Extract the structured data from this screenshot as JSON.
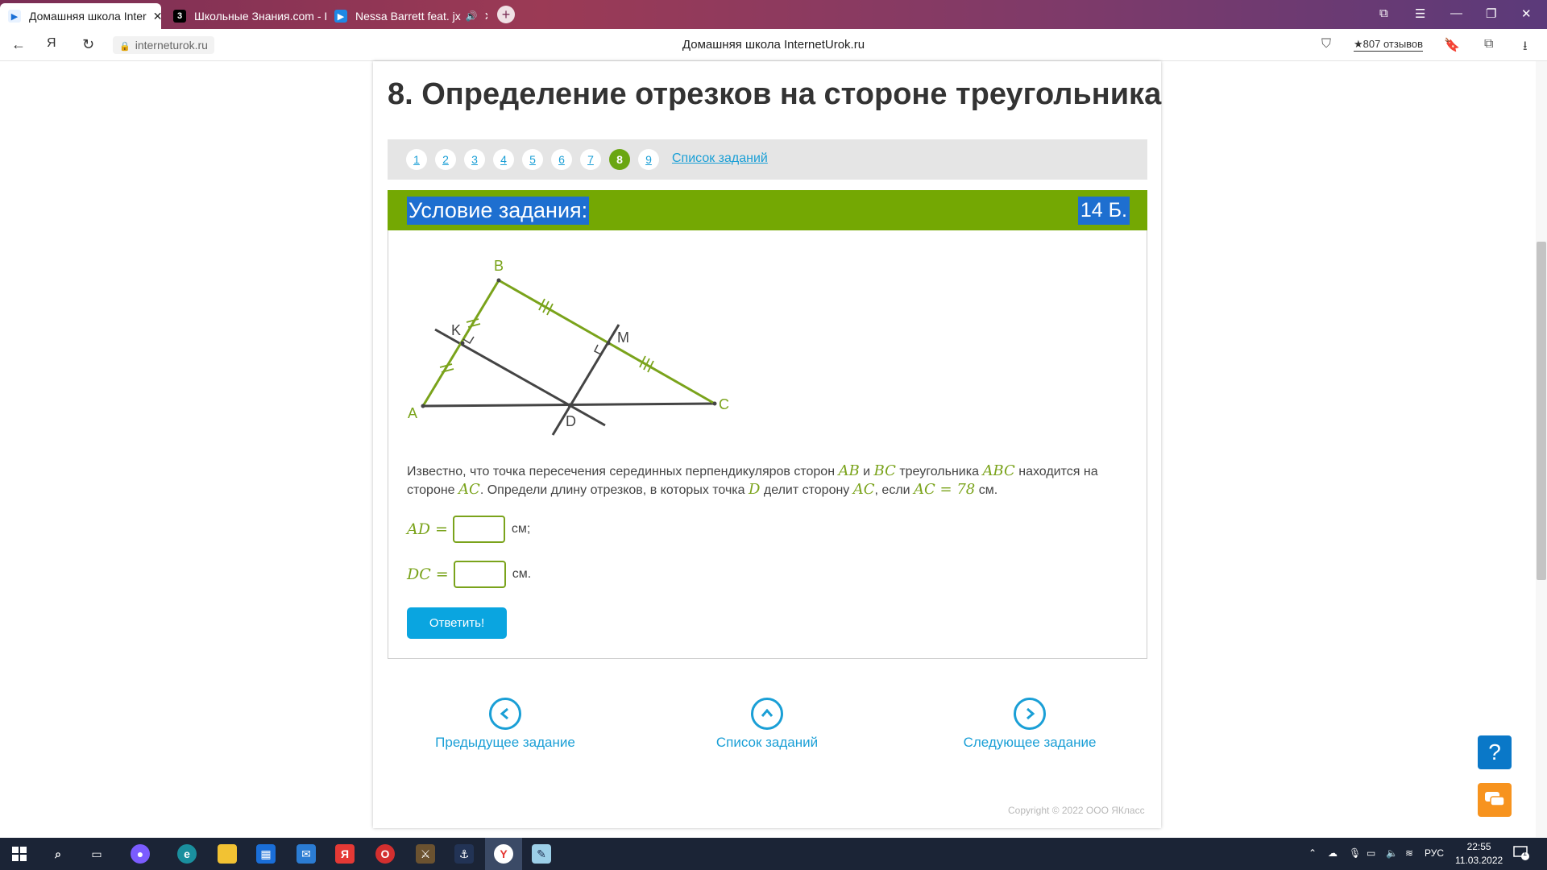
{
  "browser": {
    "tabs": [
      {
        "label": "Домашняя школа Inter",
        "active": true
      },
      {
        "label": "Школьные Знания.com - I",
        "active": false
      },
      {
        "label": "Nessa Barrett feat. jx",
        "active": false
      }
    ],
    "new_tab": "+",
    "url": "interneturok.ru",
    "page_title": "Домашняя школа InternetUrok.ru",
    "reviews": "★807 отзывов"
  },
  "page": {
    "title": "8. Определение отрезков на стороне треугольника",
    "task_numbers": [
      "1",
      "2",
      "3",
      "4",
      "5",
      "6",
      "7",
      "8",
      "9"
    ],
    "current_task": "8",
    "task_list_link": "Список заданий",
    "condition_title": "Условие задания:",
    "points": "14 Б."
  },
  "diagram": {
    "labels": {
      "A": "A",
      "B": "B",
      "C": "C",
      "K": "K",
      "M": "M",
      "D": "D"
    },
    "colors": {
      "triangle": "#7aa31b",
      "lines": "#444444"
    }
  },
  "problem": {
    "t1": "Известно, что точка пересечения серединных перпендикуляров сторон ",
    "AB": "AB",
    "t2": " и ",
    "BC": "BC",
    "t3": " треугольника ",
    "ABC": "ABC",
    "t4": " находится на стороне ",
    "AC1": "AC",
    "t5": ". Определи длину отрезков, в которых точка ",
    "D": "D",
    "t6": " делит сторону ",
    "AC2": "AC",
    "t7": ", если ",
    "AC3": "AC = 78",
    "t8": " см."
  },
  "answers": {
    "ad_label": "AD =",
    "ad_unit": "см;",
    "dc_label": "DC =",
    "dc_unit": "см."
  },
  "submit": "Ответить!",
  "bottom_nav": {
    "prev": "Предыдущее задание",
    "list": "Список заданий",
    "next": "Следующее задание"
  },
  "copyright": "Copyright © 2022 ООО ЯКласс",
  "side_buttons": {
    "help": "?"
  },
  "taskbar": {
    "lang": "РУС",
    "time": "22:55",
    "date": "11.03.2022",
    "notifications": "1"
  }
}
